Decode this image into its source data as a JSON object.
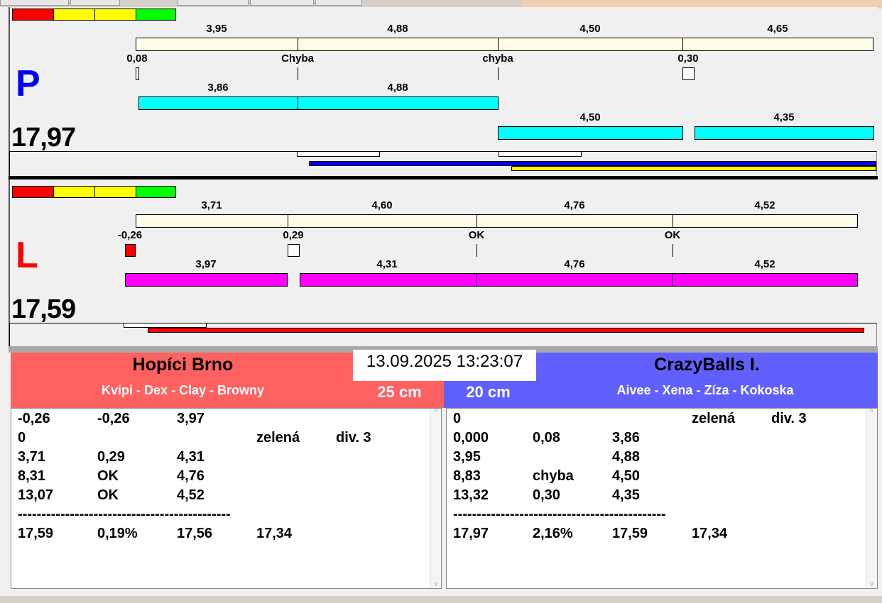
{
  "colors": {
    "red": "#ff0000",
    "yellow": "#ffff00",
    "green": "#00ff00",
    "cream": "#fffde8",
    "cyan": "#00ffff",
    "magenta": "#ff00ff",
    "blue": "#0000ff",
    "teamRed": "#ff6060",
    "teamBlue": "#6060ff"
  },
  "p": {
    "side": "P",
    "total": "17,97",
    "top_labels": [
      "3,95",
      "4,88",
      "4,50",
      "4,65"
    ],
    "mid_labels": [
      "0,08",
      "Chyba",
      "chyba",
      "0,30"
    ],
    "row1_labels": [
      "3,86",
      "4,88"
    ],
    "row2_labels": [
      "4,50",
      "4,35"
    ]
  },
  "l": {
    "side": "L",
    "total": "17,59",
    "top_labels": [
      "3,71",
      "4,60",
      "4,76",
      "4,52"
    ],
    "mid_labels": [
      "-0,26",
      "0,29",
      "OK",
      "OK"
    ],
    "row_labels": [
      "3,97",
      "4,31",
      "4,76",
      "4,52"
    ]
  },
  "left_team": {
    "name": "Hopíci Brno",
    "members": "Kvipi - Dex - Clay - Browny",
    "height": "25 cm",
    "rows": [
      [
        "-0,26",
        "-0,26",
        "3,97",
        "",
        ""
      ],
      [
        "0",
        "",
        "",
        "zelená",
        "div. 3"
      ],
      [
        "3,71",
        "0,29",
        "4,31",
        "",
        ""
      ],
      [
        "8,31",
        "OK",
        "4,76",
        "",
        ""
      ],
      [
        "13,07",
        "OK",
        "4,52",
        "",
        ""
      ],
      [
        "---------------------------------------------",
        "",
        "",
        "",
        ""
      ],
      [
        "17,59",
        "0,19%",
        "17,56",
        "17,34",
        ""
      ]
    ]
  },
  "right_team": {
    "name": "CrazyBalls I.",
    "members": "Aivee - Xena - Zíza - Kokoska",
    "height": "20 cm",
    "rows": [
      [
        "0",
        "",
        "",
        "zelená",
        "div. 3"
      ],
      [
        "0,000",
        "0,08",
        "3,86",
        "",
        ""
      ],
      [
        "3,95",
        "",
        "4,88",
        "",
        ""
      ],
      [
        "8,83",
        "chyba",
        "4,50",
        "",
        ""
      ],
      [
        "13,32",
        "0,30",
        "4,35",
        "",
        ""
      ],
      [
        "---------------------------------------------",
        "",
        "",
        "",
        ""
      ],
      [
        "17,97",
        "2,16%",
        "17,59",
        "17,34",
        ""
      ]
    ]
  },
  "datetime": "13.09.2025 13:23:07"
}
